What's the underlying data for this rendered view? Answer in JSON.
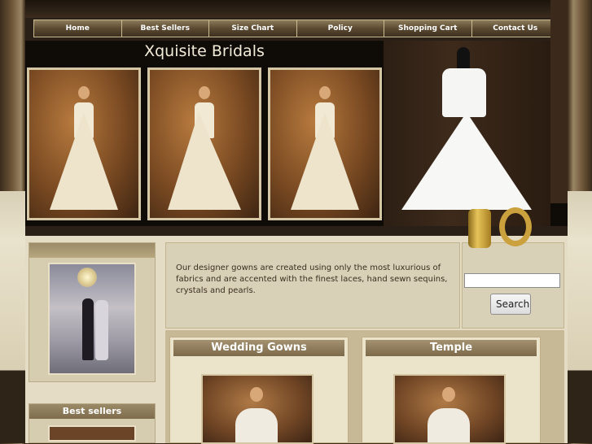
{
  "nav": {
    "items": [
      "Home",
      "Best Sellers",
      "Size Chart",
      "Policy",
      "Shopping Cart",
      "Contact Us"
    ]
  },
  "hero": {
    "title": "Xquisite Bridals",
    "photos": [
      "bride-photo-1",
      "bride-photo-2",
      "bride-photo-3"
    ],
    "feature": "strapless-gown-on-mannequin"
  },
  "intro": {
    "text": "Our designer gowns are created using only the most luxurious of fabrics and are accented with the finest laces, hand sewn sequins, crystals and pearls."
  },
  "search": {
    "value": "",
    "button_label": "Search"
  },
  "sidebar": {
    "best_sellers_label": "Best sellers"
  },
  "categories": {
    "wedding_gowns": "Wedding Gowns",
    "temple": "Temple"
  },
  "colors": {
    "nav_bg": "#5b4a31",
    "page_bg": "#2b2017",
    "content_bg": "#e4dcc4",
    "header_text": "#ffffff"
  }
}
